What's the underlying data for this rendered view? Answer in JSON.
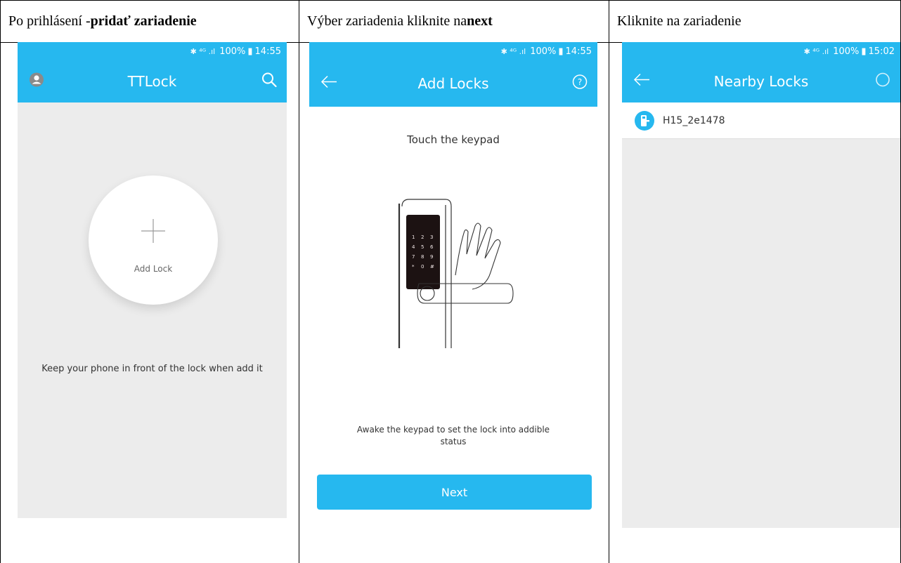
{
  "document": {
    "headers": [
      {
        "plain": "Po prihlásení  - ",
        "bold": "pridať zariadenie"
      },
      {
        "plain": "Výber zariadenia kliknite na ",
        "bold": "next"
      },
      {
        "plain": "Kliknite na zariadenie",
        "bold": ""
      }
    ]
  },
  "colors": {
    "accent": "#26b8ef",
    "screen_bg": "#ececec"
  },
  "screen1": {
    "status": {
      "signal": "100%",
      "time": "14:55"
    },
    "title": "TTLock",
    "left_icon": "avatar-icon",
    "right_icon": "search-icon",
    "add_label": "Add Lock",
    "hint": "Keep your phone in front of the lock when add it"
  },
  "screen2": {
    "status": {
      "signal": "100%",
      "time": "14:55"
    },
    "title": "Add Locks",
    "left_icon": "back-arrow-icon",
    "right_icon": "help-icon",
    "heading": "Touch the keypad",
    "keypad_keys": [
      "1",
      "2",
      "3",
      "4",
      "5",
      "6",
      "7",
      "8",
      "9",
      "*",
      "0",
      "#"
    ],
    "instruction": "Awake the keypad to set the lock into addible status",
    "next_label": "Next"
  },
  "screen3": {
    "status": {
      "signal": "100%",
      "time": "15:02"
    },
    "title": "Nearby Locks",
    "left_icon": "back-arrow-icon",
    "right_icon": "refresh-spinner-icon",
    "locks": [
      {
        "name": "H15_2e1478"
      }
    ]
  }
}
